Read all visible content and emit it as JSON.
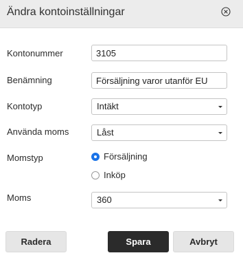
{
  "dialog": {
    "title": "Ändra kontoinställningar",
    "close_icon": "close-circle-icon"
  },
  "form": {
    "account_number": {
      "label": "Kontonummer",
      "value": "3105"
    },
    "name": {
      "label": "Benämning",
      "value": "Försäljning varor utanför EU"
    },
    "account_type": {
      "label": "Kontotyp",
      "value": "Intäkt"
    },
    "use_vat": {
      "label": "Använda moms",
      "value": "Låst"
    },
    "vat_type": {
      "label": "Momstyp",
      "options": [
        {
          "label": "Försäljning",
          "selected": true
        },
        {
          "label": "Inköp",
          "selected": false
        }
      ]
    },
    "vat": {
      "label": "Moms",
      "value": "360"
    }
  },
  "buttons": {
    "delete": "Radera",
    "save": "Spara",
    "cancel": "Avbryt"
  },
  "colors": {
    "accent": "#1a73e8",
    "primary_button": "#2b2b2b",
    "header_bg": "#ececec"
  }
}
